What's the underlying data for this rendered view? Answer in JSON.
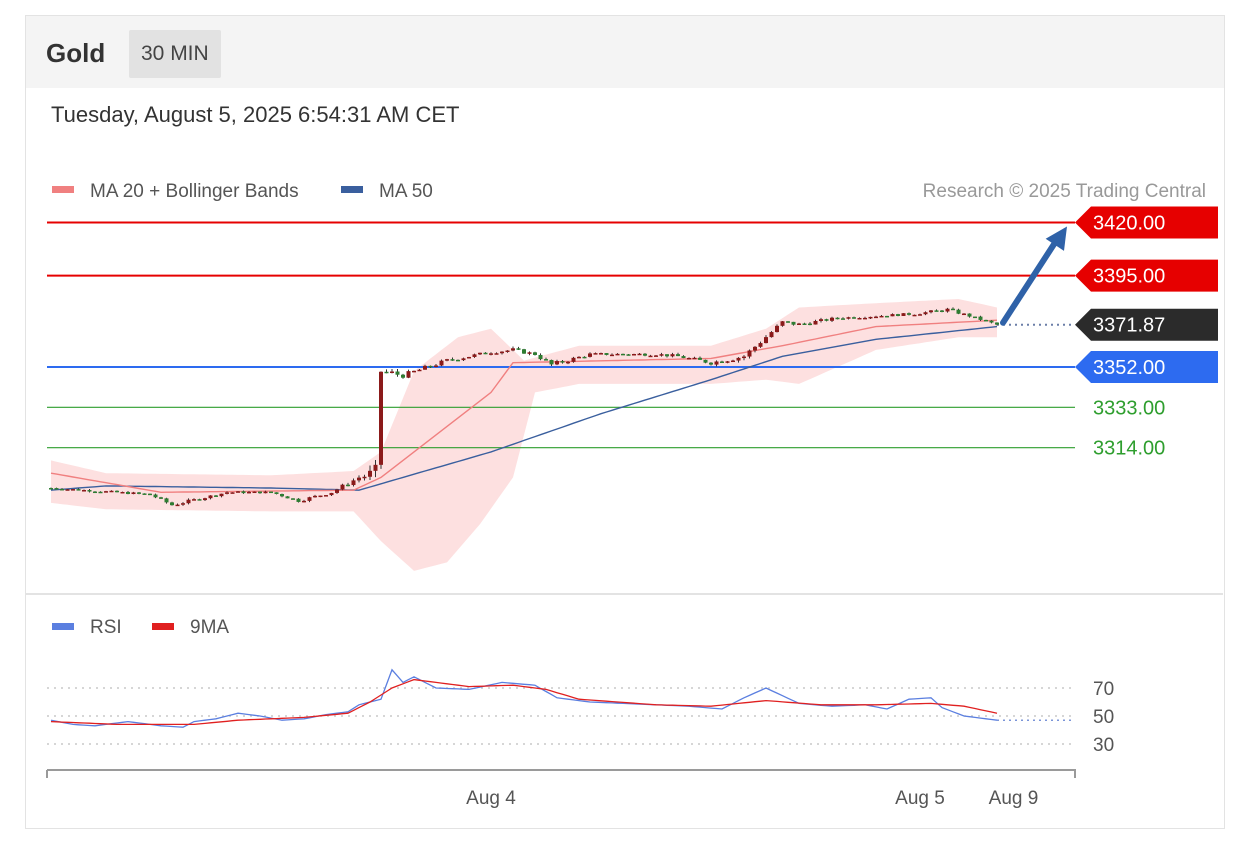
{
  "header": {
    "instrument": "Gold",
    "timeframe": "30 MIN",
    "datetime": "Tuesday, August 5, 2025 6:54:31 AM CET"
  },
  "legend": {
    "ma20": {
      "label": "MA 20 + Bollinger Bands",
      "color": "#f08080"
    },
    "ma50": {
      "label": "MA 50",
      "color": "#3a5f9e"
    },
    "attribution": "Research © 2025 Trading Central"
  },
  "rsi_legend": {
    "rsi": {
      "label": "RSI",
      "color": "#5b7fe0"
    },
    "ma9": {
      "label": "9MA",
      "color": "#e02020"
    }
  },
  "levels": [
    {
      "value": 3420.0,
      "label": "3420.00",
      "kind": "resistance",
      "color": "#e60000"
    },
    {
      "value": 3395.0,
      "label": "3395.00",
      "kind": "resistance",
      "color": "#e60000"
    },
    {
      "value": 3371.87,
      "label": "3371.87",
      "kind": "last-price",
      "color": "#2b2b2b"
    },
    {
      "value": 3352.0,
      "label": "3352.00",
      "kind": "pivot",
      "color": "#2d6bf0"
    },
    {
      "value": 3333.0,
      "label": "3333.00",
      "kind": "support",
      "color": "#2e9e2e"
    },
    {
      "value": 3314.0,
      "label": "3314.00",
      "kind": "support",
      "color": "#2e9e2e"
    }
  ],
  "chart_data": [
    {
      "type": "candlestick",
      "title": "Gold",
      "price_range": [
        3247,
        3440
      ],
      "x_ticks": [
        {
          "index": 80,
          "label": "Aug 4"
        },
        {
          "index": 158,
          "label": "Aug 5"
        },
        {
          "index": 175,
          "label": "Aug 9"
        }
      ],
      "last_index": 172,
      "price_path": [
        [
          0,
          3295,
          0.5
        ],
        [
          18,
          3292,
          0.6
        ],
        [
          22,
          3287,
          0.8
        ],
        [
          32,
          3293,
          0.6
        ],
        [
          40,
          3293,
          0.5
        ],
        [
          45,
          3289,
          0.7
        ],
        [
          51,
          3293,
          0.8
        ],
        [
          56,
          3300,
          1.2
        ],
        [
          59,
          3302,
          4.0
        ],
        [
          60,
          3350,
          2.2
        ],
        [
          64,
          3348,
          1.2
        ],
        [
          72,
          3355,
          1.0
        ],
        [
          80,
          3359,
          0.8
        ],
        [
          84,
          3360,
          1.0
        ],
        [
          88,
          3358,
          0.8
        ],
        [
          91,
          3353,
          1.2
        ],
        [
          98,
          3358,
          0.7
        ],
        [
          110,
          3358,
          0.7
        ],
        [
          114,
          3357,
          0.8
        ],
        [
          120,
          3354,
          1.0
        ],
        [
          126,
          3357,
          1.4
        ],
        [
          133,
          3373,
          1.1
        ],
        [
          136,
          3372,
          1.0
        ],
        [
          143,
          3375,
          0.7
        ],
        [
          150,
          3376,
          0.6
        ],
        [
          157,
          3377,
          0.6
        ],
        [
          163,
          3379,
          0.8
        ],
        [
          167,
          3376,
          0.6
        ],
        [
          172,
          3371.87,
          0.5
        ]
      ],
      "ma20_path": [
        [
          0,
          3302
        ],
        [
          20,
          3293
        ],
        [
          55,
          3294
        ],
        [
          60,
          3300
        ],
        [
          80,
          3340
        ],
        [
          84,
          3354
        ],
        [
          120,
          3356
        ],
        [
          133,
          3362
        ],
        [
          150,
          3371
        ],
        [
          172,
          3374
        ]
      ],
      "ma50_path": [
        [
          0,
          3294
        ],
        [
          10,
          3296
        ],
        [
          40,
          3295
        ],
        [
          56,
          3294
        ],
        [
          80,
          3312
        ],
        [
          100,
          3330
        ],
        [
          120,
          3346
        ],
        [
          133,
          3357
        ],
        [
          150,
          3365
        ],
        [
          172,
          3371
        ]
      ],
      "bb_upper": [
        [
          0,
          3308
        ],
        [
          10,
          3302
        ],
        [
          40,
          3301
        ],
        [
          55,
          3303
        ],
        [
          60,
          3312
        ],
        [
          66,
          3350
        ],
        [
          74,
          3366
        ],
        [
          80,
          3370
        ],
        [
          86,
          3355
        ],
        [
          96,
          3362
        ],
        [
          120,
          3362
        ],
        [
          130,
          3370
        ],
        [
          136,
          3380
        ],
        [
          150,
          3382
        ],
        [
          165,
          3384
        ],
        [
          172,
          3380
        ]
      ],
      "bb_lower": [
        [
          0,
          3288
        ],
        [
          10,
          3285
        ],
        [
          40,
          3284
        ],
        [
          55,
          3284
        ],
        [
          60,
          3270
        ],
        [
          66,
          3256
        ],
        [
          72,
          3260
        ],
        [
          78,
          3278
        ],
        [
          84,
          3300
        ],
        [
          88,
          3340
        ],
        [
          96,
          3344
        ],
        [
          120,
          3344
        ],
        [
          130,
          3346
        ],
        [
          136,
          3344
        ],
        [
          150,
          3360
        ],
        [
          165,
          3366
        ],
        [
          172,
          3366
        ]
      ],
      "projection": {
        "from_index": 172,
        "from": 3371.87,
        "to_index": 180,
        "to": 3420.0
      },
      "rsi": {
        "range": [
          20,
          100
        ],
        "levels": [
          {
            "value": 70,
            "label": "70"
          },
          {
            "value": 50,
            "label": "50"
          },
          {
            "value": 30,
            "label": "30"
          }
        ],
        "rsi_path": [
          [
            0,
            47
          ],
          [
            4,
            44
          ],
          [
            8,
            43
          ],
          [
            14,
            46
          ],
          [
            20,
            43
          ],
          [
            24,
            42
          ],
          [
            26,
            46
          ],
          [
            30,
            48
          ],
          [
            34,
            52
          ],
          [
            38,
            50
          ],
          [
            42,
            47
          ],
          [
            46,
            48
          ],
          [
            50,
            51
          ],
          [
            54,
            53
          ],
          [
            56,
            58
          ],
          [
            60,
            62
          ],
          [
            62,
            83
          ],
          [
            64,
            74
          ],
          [
            66,
            78
          ],
          [
            70,
            70
          ],
          [
            76,
            69
          ],
          [
            82,
            74
          ],
          [
            88,
            72
          ],
          [
            92,
            63
          ],
          [
            98,
            60
          ],
          [
            104,
            59
          ],
          [
            110,
            58
          ],
          [
            116,
            57
          ],
          [
            122,
            55
          ],
          [
            126,
            63
          ],
          [
            130,
            70
          ],
          [
            136,
            59
          ],
          [
            142,
            57
          ],
          [
            148,
            58
          ],
          [
            152,
            55
          ],
          [
            156,
            62
          ],
          [
            160,
            63
          ],
          [
            162,
            56
          ],
          [
            166,
            50
          ],
          [
            172,
            47
          ]
        ],
        "ma9_path": [
          [
            0,
            46
          ],
          [
            12,
            44
          ],
          [
            26,
            44
          ],
          [
            34,
            47
          ],
          [
            46,
            49
          ],
          [
            54,
            52
          ],
          [
            58,
            60
          ],
          [
            62,
            70
          ],
          [
            66,
            76
          ],
          [
            70,
            74
          ],
          [
            76,
            71
          ],
          [
            84,
            72
          ],
          [
            90,
            69
          ],
          [
            96,
            62
          ],
          [
            110,
            58
          ],
          [
            120,
            57
          ],
          [
            130,
            61
          ],
          [
            140,
            58
          ],
          [
            150,
            58
          ],
          [
            160,
            59
          ],
          [
            166,
            57
          ],
          [
            172,
            52
          ]
        ]
      }
    }
  ]
}
